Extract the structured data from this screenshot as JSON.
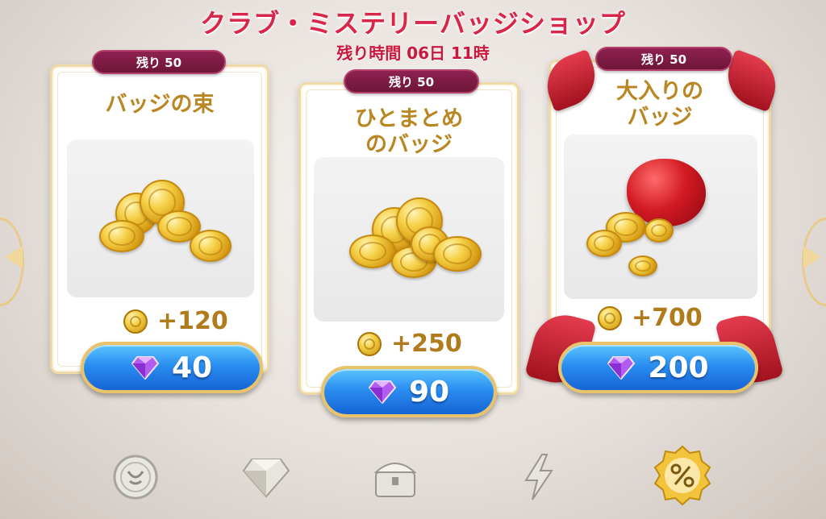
{
  "header": {
    "title": "クラブ・ミステリーバッジショップ",
    "timer": "残り時間 06日 11時"
  },
  "offers": [
    {
      "stock_label": "残り 50",
      "title_line1": "バッジの束",
      "title_line2": "",
      "reward": "+120",
      "price": "40"
    },
    {
      "stock_label": "残り 50",
      "title_line1": "ひとまとめ",
      "title_line2": "のバッジ",
      "reward": "+250",
      "price": "90"
    },
    {
      "stock_label": "残り 50",
      "title_line1": "大入りの",
      "title_line2": "バッジ",
      "reward": "+700",
      "price": "200"
    }
  ],
  "bottom_tabs": [
    {
      "icon": "badge-coin-icon"
    },
    {
      "icon": "diamond-icon"
    },
    {
      "icon": "treasure-chest-icon"
    },
    {
      "icon": "lightning-icon"
    },
    {
      "icon": "percent-badge-icon",
      "selected": true
    }
  ],
  "colors": {
    "title": "#d8254a",
    "badge_bg": "#7a1a42",
    "card_title": "#b98622",
    "button_blue": "#2a8ef0",
    "ribbon_red": "#c81d2e",
    "gem_purple": "#b25cf2"
  }
}
